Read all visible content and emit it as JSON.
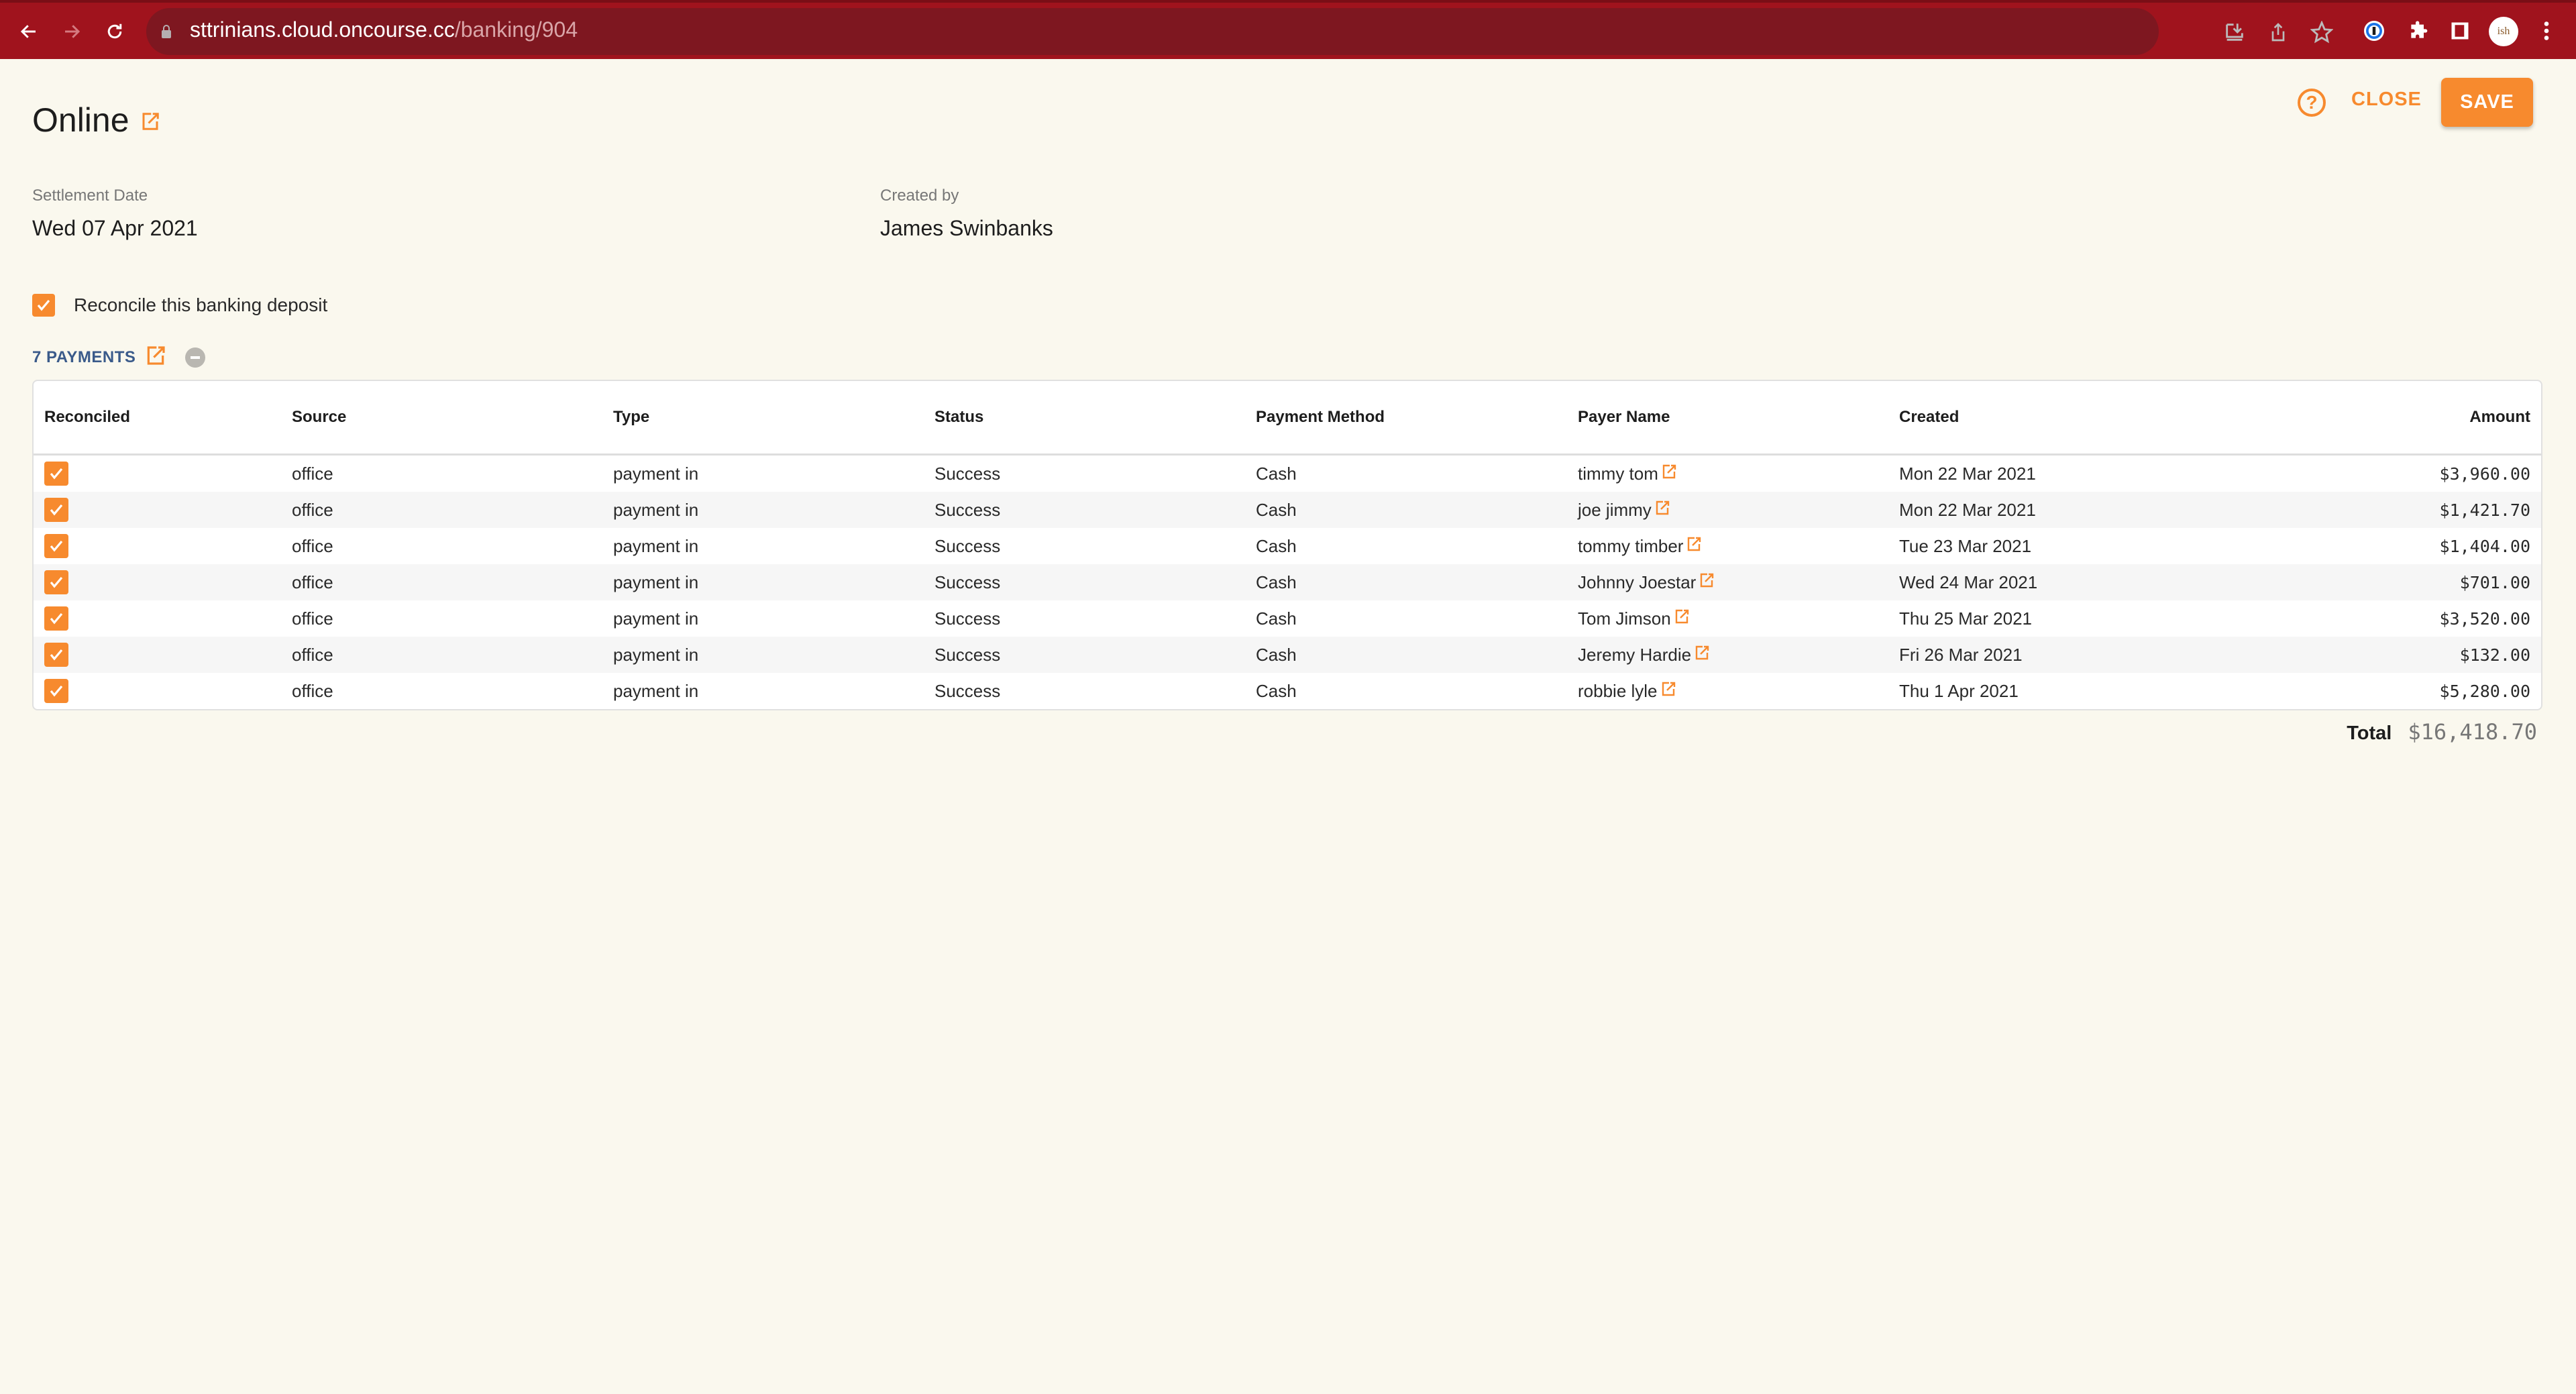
{
  "browser": {
    "url_host": "sttrinians.cloud.oncourse.cc",
    "url_path": "/banking/904",
    "avatar_text": "ish"
  },
  "header": {
    "title": "Online",
    "close_label": "CLOSE",
    "save_label": "SAVE"
  },
  "fields": {
    "settlement_date_label": "Settlement Date",
    "settlement_date_value": "Wed 07 Apr 2021",
    "created_by_label": "Created by",
    "created_by_value": "James Swinbanks"
  },
  "reconcile": {
    "label": "Reconcile this banking deposit",
    "checked": true
  },
  "payments": {
    "header_label": "7 PAYMENTS",
    "columns": [
      "Reconciled",
      "Source",
      "Type",
      "Status",
      "Payment Method",
      "Payer Name",
      "Created",
      "Amount"
    ],
    "rows": [
      {
        "reconciled": true,
        "source": "office",
        "type": "payment in",
        "status": "Success",
        "method": "Cash",
        "payer": "timmy tom",
        "created": "Mon 22 Mar 2021",
        "amount": "$3,960.00"
      },
      {
        "reconciled": true,
        "source": "office",
        "type": "payment in",
        "status": "Success",
        "method": "Cash",
        "payer": "joe jimmy",
        "created": "Mon 22 Mar 2021",
        "amount": "$1,421.70"
      },
      {
        "reconciled": true,
        "source": "office",
        "type": "payment in",
        "status": "Success",
        "method": "Cash",
        "payer": "tommy timber",
        "created": "Tue 23 Mar 2021",
        "amount": "$1,404.00"
      },
      {
        "reconciled": true,
        "source": "office",
        "type": "payment in",
        "status": "Success",
        "method": "Cash",
        "payer": "Johnny Joestar",
        "created": "Wed 24 Mar 2021",
        "amount": "$701.00"
      },
      {
        "reconciled": true,
        "source": "office",
        "type": "payment in",
        "status": "Success",
        "method": "Cash",
        "payer": "Tom Jimson",
        "created": "Thu 25 Mar 2021",
        "amount": "$3,520.00"
      },
      {
        "reconciled": true,
        "source": "office",
        "type": "payment in",
        "status": "Success",
        "method": "Cash",
        "payer": "Jeremy Hardie",
        "created": "Fri 26 Mar 2021",
        "amount": "$132.00"
      },
      {
        "reconciled": true,
        "source": "office",
        "type": "payment in",
        "status": "Success",
        "method": "Cash",
        "payer": "robbie lyle",
        "created": "Thu 1 Apr 2021",
        "amount": "$5,280.00"
      }
    ],
    "total_label": "Total",
    "total_value": "$16,418.70"
  },
  "colors": {
    "accent": "#f78a2e",
    "chrome": "#a0131d",
    "background": "#faf8ee",
    "link_blue": "#3a5a8a"
  }
}
